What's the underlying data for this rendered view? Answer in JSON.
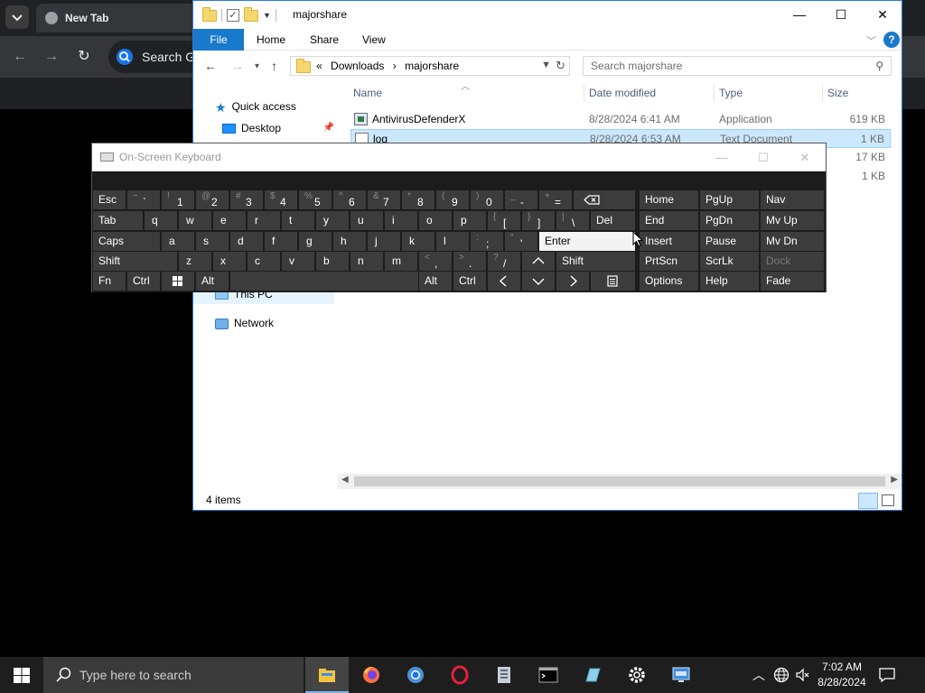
{
  "browser": {
    "tab_title": "New Tab",
    "search_placeholder": "Search Google or type a URL",
    "icons": [
      "chevron-down-icon",
      "back-arrow-icon",
      "forward-arrow-icon",
      "reload-icon",
      "google-icon"
    ]
  },
  "explorer": {
    "window_title": "majorshare",
    "ribbon_tabs": [
      "File",
      "Home",
      "Share",
      "View"
    ],
    "breadcrumb": [
      "«",
      "Downloads",
      "›",
      "majorshare"
    ],
    "search_placeholder": "Search majorshare",
    "nav_items": [
      {
        "label": "Quick access",
        "icon": "star-icon"
      },
      {
        "label": "Desktop",
        "icon": "desktop-icon"
      },
      {
        "label": "This PC",
        "icon": "computer-icon"
      },
      {
        "label": "Network",
        "icon": "network-icon"
      }
    ],
    "columns": {
      "name": "Name",
      "date": "Date modified",
      "type": "Type",
      "size": "Size"
    },
    "files": [
      {
        "name": "AntivirusDefenderX",
        "date": "8/28/2024 6:41 AM",
        "type": "Application",
        "size": "619 KB"
      },
      {
        "name": "log",
        "date": "8/28/2024 6:53 AM",
        "type": "Text Document",
        "size": "1 KB"
      },
      {
        "size": "17 KB"
      },
      {
        "size": "1 KB"
      }
    ],
    "status": "4 items"
  },
  "osk": {
    "title": "On-Screen Keyboard",
    "row1": [
      {
        "main": "Esc"
      },
      {
        "sup": "~",
        "main": "`"
      },
      {
        "sup": "!",
        "main": "1"
      },
      {
        "sup": "@",
        "main": "2"
      },
      {
        "sup": "#",
        "main": "3"
      },
      {
        "sup": "$",
        "main": "4"
      },
      {
        "sup": "%",
        "main": "5"
      },
      {
        "sup": "^",
        "main": "6"
      },
      {
        "sup": "&",
        "main": "7"
      },
      {
        "sup": "*",
        "main": "8"
      },
      {
        "sup": "(",
        "main": "9"
      },
      {
        "sup": ")",
        "main": "0"
      },
      {
        "sup": "_",
        "main": "-"
      },
      {
        "sup": "+",
        "main": "="
      }
    ],
    "row2_letters": [
      "Tab",
      "q",
      "w",
      "e",
      "r",
      "t",
      "y",
      "u",
      "i",
      "o",
      "p"
    ],
    "row2_sym": [
      {
        "sup": "{",
        "main": "["
      },
      {
        "sup": "}",
        "main": "]"
      },
      {
        "sup": "|",
        "main": "\\"
      }
    ],
    "del": "Del",
    "row3_letters": [
      "Caps",
      "a",
      "s",
      "d",
      "f",
      "g",
      "h",
      "j",
      "k",
      "l"
    ],
    "row3_sym": [
      {
        "sup": ":",
        "main": ";"
      },
      {
        "sup": "\"",
        "main": "'"
      }
    ],
    "enter": "Enter",
    "row4_letters": [
      "Shift",
      "z",
      "x",
      "c",
      "v",
      "b",
      "n",
      "m"
    ],
    "row4_sym": [
      {
        "sup": "<",
        "main": ","
      },
      {
        "sup": ">",
        "main": "."
      },
      {
        "sup": "?",
        "main": "/"
      }
    ],
    "shift_right": "Shift",
    "row5": [
      "Fn",
      "Ctrl",
      "Alt",
      "Alt",
      "Ctrl"
    ],
    "nav_block": [
      [
        "Home",
        "PgUp",
        "Nav"
      ],
      [
        "End",
        "PgDn",
        "Mv Up"
      ],
      [
        "Insert",
        "Pause",
        "Mv Dn"
      ],
      [
        "PrtScn",
        "ScrLk",
        "Dock"
      ],
      [
        "Options",
        "Help",
        "Fade"
      ]
    ]
  },
  "taskbar": {
    "search_placeholder": "Type here to search",
    "apps": [
      "file-explorer-icon",
      "firefox-icon",
      "chrome-icon",
      "opera-icon",
      "document-icon",
      "terminal-icon",
      "notepad-icon",
      "settings-icon",
      "remote-desktop-icon"
    ],
    "time": "7:02 AM",
    "date": "8/28/2024"
  }
}
